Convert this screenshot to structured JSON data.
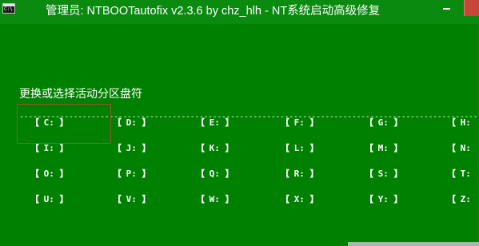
{
  "window": {
    "title": "管理员: NTBOOTautofix v2.3.6 by chz_hlh - NT系统启动高级修复",
    "minimize_symbol": "—",
    "icon": "console-icon"
  },
  "colors": {
    "console_bg": "#008000",
    "text": "#ffffff",
    "selection_border": "#a0522d",
    "close_button": "#c7463a"
  },
  "console": {
    "prompt": "更换或选择活动分区盘符",
    "separator": "-------------------------------------------------------------------------------------------------------------"
  },
  "drives": [
    {
      "letter": "C:",
      "left_bracket": "【",
      "right_bracket": "】"
    },
    {
      "letter": "D:",
      "left_bracket": "【",
      "right_bracket": "】"
    },
    {
      "letter": "E:",
      "left_bracket": "【",
      "right_bracket": "】"
    },
    {
      "letter": "F:",
      "left_bracket": "【",
      "right_bracket": "】"
    },
    {
      "letter": "G:",
      "left_bracket": "【",
      "right_bracket": "】"
    },
    {
      "letter": "H:",
      "left_bracket": "【",
      "right_bracket": ""
    },
    {
      "letter": "I:",
      "left_bracket": "【",
      "right_bracket": "】"
    },
    {
      "letter": "J:",
      "left_bracket": "【",
      "right_bracket": "】"
    },
    {
      "letter": "K:",
      "left_bracket": "【",
      "right_bracket": "】"
    },
    {
      "letter": "L:",
      "left_bracket": "【",
      "right_bracket": "】"
    },
    {
      "letter": "M:",
      "left_bracket": "【",
      "right_bracket": "】"
    },
    {
      "letter": "N:",
      "left_bracket": "【",
      "right_bracket": ""
    },
    {
      "letter": "O:",
      "left_bracket": "【",
      "right_bracket": "】"
    },
    {
      "letter": "P:",
      "left_bracket": "【",
      "right_bracket": "】"
    },
    {
      "letter": "Q:",
      "left_bracket": "【",
      "right_bracket": "】"
    },
    {
      "letter": "R:",
      "left_bracket": "【",
      "right_bracket": "】"
    },
    {
      "letter": "S:",
      "left_bracket": "【",
      "right_bracket": "】"
    },
    {
      "letter": "T:",
      "left_bracket": "【",
      "right_bracket": ""
    },
    {
      "letter": "U:",
      "left_bracket": "【",
      "right_bracket": "】"
    },
    {
      "letter": "V:",
      "left_bracket": "【",
      "right_bracket": "】"
    },
    {
      "letter": "W:",
      "left_bracket": "【",
      "right_bracket": "】"
    },
    {
      "letter": "X:",
      "left_bracket": "【",
      "right_bracket": "】"
    },
    {
      "letter": "Y:",
      "left_bracket": "【",
      "right_bracket": "】"
    },
    {
      "letter": "Z:",
      "left_bracket": "【",
      "right_bracket": ""
    }
  ]
}
